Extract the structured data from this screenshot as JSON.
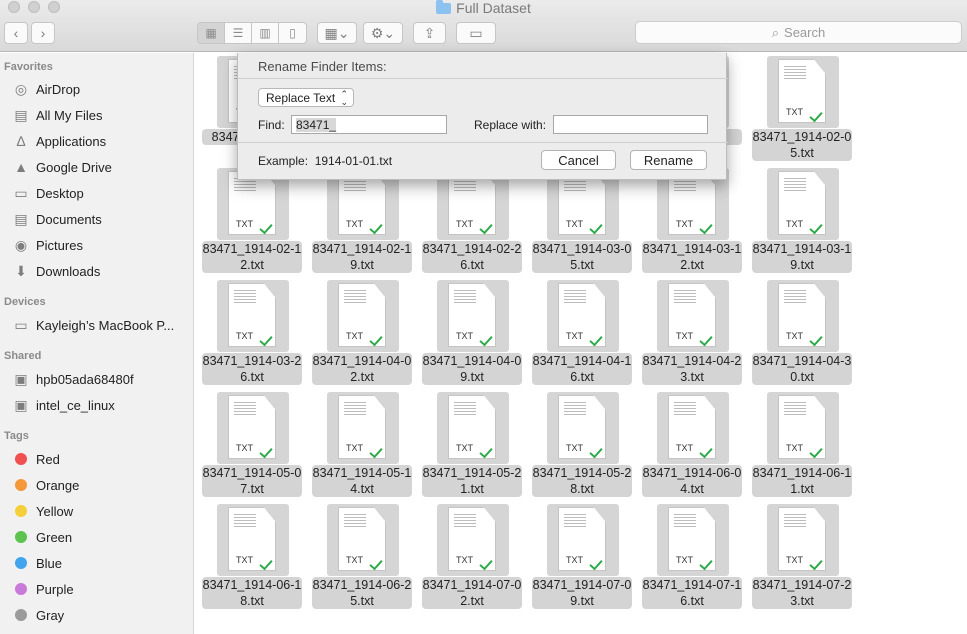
{
  "window": {
    "title": "Full Dataset"
  },
  "toolbar": {
    "back_icon": "chevron-left-icon",
    "forward_icon": "chevron-right-icon",
    "search_placeholder": "Search"
  },
  "sidebar": {
    "favorites_header": "Favorites",
    "favorites": [
      {
        "label": "AirDrop",
        "icon": "airdrop-icon"
      },
      {
        "label": "All My Files",
        "icon": "all-files-icon"
      },
      {
        "label": "Applications",
        "icon": "applications-icon"
      },
      {
        "label": "Google Drive",
        "icon": "google-drive-icon"
      },
      {
        "label": "Desktop",
        "icon": "desktop-icon"
      },
      {
        "label": "Documents",
        "icon": "documents-icon"
      },
      {
        "label": "Pictures",
        "icon": "pictures-icon"
      },
      {
        "label": "Downloads",
        "icon": "downloads-icon"
      }
    ],
    "devices_header": "Devices",
    "devices": [
      {
        "label": "Kayleigh’s MacBook P...",
        "icon": "laptop-icon"
      }
    ],
    "shared_header": "Shared",
    "shared": [
      {
        "label": "hpb05ada68480f",
        "icon": "monitor-icon"
      },
      {
        "label": "intel_ce_linux",
        "icon": "monitor-icon"
      }
    ],
    "tags_header": "Tags",
    "tags": [
      {
        "label": "Red",
        "color": "#f0504f"
      },
      {
        "label": "Orange",
        "color": "#f4983a"
      },
      {
        "label": "Yellow",
        "color": "#f5cf3a"
      },
      {
        "label": "Green",
        "color": "#5dc24f"
      },
      {
        "label": "Blue",
        "color": "#42a4ed"
      },
      {
        "label": "Purple",
        "color": "#c97ad8"
      },
      {
        "label": "Gray",
        "color": "#9b9b9b"
      }
    ]
  },
  "files": {
    "ext_label": "TXT",
    "rows": [
      [
        {
          "l1": "83471_1914-0",
          "l2": ""
        },
        {
          "l1": "",
          "l2": ""
        },
        {
          "l1": "",
          "l2": ""
        },
        {
          "l1": "",
          "l2": ""
        },
        {
          "l1": "-2",
          "l2": ""
        },
        {
          "l1": "83471_1914-02-0",
          "l2": "5.txt"
        }
      ],
      [
        {
          "l1": "83471_1914-02-1",
          "l2": "2.txt"
        },
        {
          "l1": "83471_1914-02-1",
          "l2": "9.txt"
        },
        {
          "l1": "83471_1914-02-2",
          "l2": "6.txt"
        },
        {
          "l1": "83471_1914-03-0",
          "l2": "5.txt"
        },
        {
          "l1": "83471_1914-03-1",
          "l2": "2.txt"
        },
        {
          "l1": "83471_1914-03-1",
          "l2": "9.txt"
        }
      ],
      [
        {
          "l1": "83471_1914-03-2",
          "l2": "6.txt"
        },
        {
          "l1": "83471_1914-04-0",
          "l2": "2.txt"
        },
        {
          "l1": "83471_1914-04-0",
          "l2": "9.txt"
        },
        {
          "l1": "83471_1914-04-1",
          "l2": "6.txt"
        },
        {
          "l1": "83471_1914-04-2",
          "l2": "3.txt"
        },
        {
          "l1": "83471_1914-04-3",
          "l2": "0.txt"
        }
      ],
      [
        {
          "l1": "83471_1914-05-0",
          "l2": "7.txt"
        },
        {
          "l1": "83471_1914-05-1",
          "l2": "4.txt"
        },
        {
          "l1": "83471_1914-05-2",
          "l2": "1.txt"
        },
        {
          "l1": "83471_1914-05-2",
          "l2": "8.txt"
        },
        {
          "l1": "83471_1914-06-0",
          "l2": "4.txt"
        },
        {
          "l1": "83471_1914-06-1",
          "l2": "1.txt"
        }
      ],
      [
        {
          "l1": "83471_1914-06-1",
          "l2": "8.txt"
        },
        {
          "l1": "83471_1914-06-2",
          "l2": "5.txt"
        },
        {
          "l1": "83471_1914-07-0",
          "l2": "2.txt"
        },
        {
          "l1": "83471_1914-07-0",
          "l2": "9.txt"
        },
        {
          "l1": "83471_1914-07-1",
          "l2": "6.txt"
        },
        {
          "l1": "83471_1914-07-2",
          "l2": "3.txt"
        }
      ]
    ]
  },
  "rename_dialog": {
    "title": "Rename Finder Items:",
    "mode": "Replace Text",
    "find_label": "Find:",
    "find_value": "83471_",
    "replace_label": "Replace with:",
    "replace_value": "",
    "example_label": "Example:",
    "example_value": "1914-01-01.txt",
    "cancel_label": "Cancel",
    "rename_label": "Rename"
  }
}
